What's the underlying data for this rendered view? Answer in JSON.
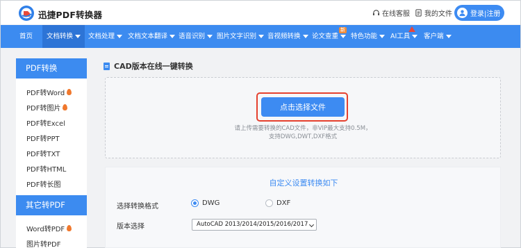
{
  "header": {
    "brand": "迅捷PDF转换器",
    "links": [
      {
        "label": "在线客服",
        "icon": "headset-icon"
      },
      {
        "label": "我的文件",
        "icon": "file-icon"
      }
    ],
    "login_label": "登录|注册"
  },
  "nav": {
    "items": [
      {
        "label": "首页",
        "has_caret": false
      },
      {
        "label": "文档转换",
        "has_caret": true,
        "active": true
      },
      {
        "label": "文档处理",
        "has_caret": true
      },
      {
        "label": "文档文本翻译",
        "has_caret": true
      },
      {
        "label": "语音识别",
        "has_caret": true
      },
      {
        "label": "图片文字识别",
        "has_caret": true
      },
      {
        "label": "音视频转换",
        "has_caret": true
      },
      {
        "label": "论文查重",
        "has_caret": true,
        "badge": "新"
      },
      {
        "label": "特色功能",
        "has_caret": true
      },
      {
        "label": "AI工具",
        "has_caret": true
      },
      {
        "label": "客户端",
        "has_caret": true
      }
    ]
  },
  "sidebar": {
    "sections": [
      {
        "title": "PDF转换",
        "items": [
          {
            "label": "PDF转Word",
            "hot": true
          },
          {
            "label": "PDF转图片",
            "hot": true
          },
          {
            "label": "PDF转Excel",
            "hot": false
          },
          {
            "label": "PDF转PPT",
            "hot": false
          },
          {
            "label": "PDF转TXT",
            "hot": false
          },
          {
            "label": "PDF转HTML",
            "hot": false
          },
          {
            "label": "PDF转长图",
            "hot": false
          }
        ]
      },
      {
        "title": "其它转PDF",
        "items": [
          {
            "label": "Word转PDF",
            "hot": true
          },
          {
            "label": "图片转PDF",
            "hot": false
          }
        ]
      }
    ]
  },
  "main": {
    "title": "CAD版本在线一键转换",
    "upload_button": "点击选择文件",
    "hint_line1": "请上传需要转换的CAD文件，非VIP最大支持0.5M，",
    "hint_line2": "支持DWG,DWT,DXF格式",
    "settings": {
      "title": "自定义设置转换如下",
      "format_label": "选择转换格式",
      "format_options": [
        {
          "label": "DWG",
          "selected": true
        },
        {
          "label": "DXF",
          "selected": false
        }
      ],
      "version_label": "版本选择",
      "version_value": "AutoCAD 2013/2014/2015/2016/2017"
    }
  },
  "colors": {
    "primary": "#3c8bf0",
    "highlight_border": "#e5402e",
    "hot": "#f0782d"
  }
}
